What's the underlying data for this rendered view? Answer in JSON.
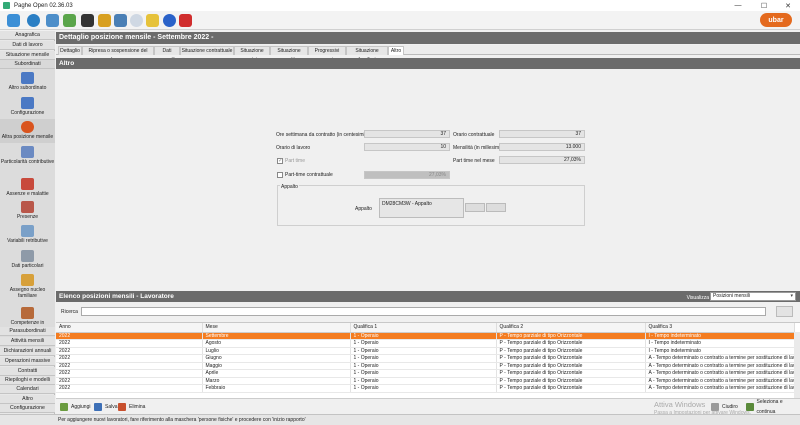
{
  "window": {
    "title": "Paghe Open 02.36.03",
    "brand": "ubar"
  },
  "toolbar_icons": [
    "home-icon",
    "globe-icon",
    "refresh-icon",
    "edit-icon",
    "bug-icon",
    "people-icon",
    "network-icon",
    "cloud-icon",
    "folder-icon",
    "info-icon",
    "close-icon"
  ],
  "sidebar": {
    "headers": [
      "Anagrafica",
      "Dati di lavoro",
      "Situazione mensile",
      "Subordinati"
    ],
    "items": [
      "Altro subordinato",
      "Configurazione",
      "Altra posizione mensile",
      "Particolarità contributive",
      "Assenze e malattie",
      "Presenze",
      "Variabili retributive",
      "Dati particolari",
      "Assegno nucleo familiare",
      "Competenze in"
    ],
    "footer": [
      "Parasubordinati",
      "Attività mensili",
      "Dichiarazioni annuali",
      "Operazioni massive",
      "Contratti",
      "Riepiloghi e modelli",
      "Calendari",
      "Altro",
      "Configurazione"
    ]
  },
  "detail": {
    "title": "Dettaglio posizione mensile - Settembre 2022 -",
    "tabs": [
      "Dettaglio",
      "Ripresa o sospensione del lavoro",
      "Dati mensili",
      "Situazione contrattuale",
      "Situazione ratei",
      "Situazione scatti",
      "Progressivi annui",
      "Situazione familiari",
      "Altro"
    ],
    "section": "Altro",
    "fields": {
      "ore_sett_label": "Ore settimana da contratto (in centesimi)",
      "ore_sett": "37",
      "orario_contr_label": "Orario contrattuale",
      "orario_contr": "37",
      "orario_lavoro_label": "Orario di lavoro",
      "orario_lavoro": "10",
      "mensilita_label": "Mensilità (in millesimi)",
      "mensilita": "13.000",
      "part_time_label": "Part time",
      "pt_mese_label": "Part time nel mese",
      "pt_mese": "27,03%",
      "pt_contr_label": "Part-time contrattuale",
      "pt_contr": "27,03%",
      "appalto_group": "Appalto",
      "appalto_label": "Appalto",
      "appalto_value": "DM28CM3W - Appalto"
    }
  },
  "list": {
    "title": "Elenco posizioni mensili - Lavoratore",
    "visualizza_label": "Visualizza",
    "visualizza_value": "Posizioni mensili",
    "search_label": "Ricerca",
    "columns": [
      "Anno",
      "Mese",
      "Qualifica 1",
      "Qualifica 2",
      "Qualifica 3"
    ],
    "rows": [
      [
        "2022",
        "Settembre",
        "1 - Operaio",
        "P - Tempo parziale di tipo Orizzontale",
        "I - Tempo indeterminato"
      ],
      [
        "2022",
        "Agosto",
        "1 - Operaio",
        "P - Tempo parziale di tipo Orizzontale",
        "I - Tempo indeterminato"
      ],
      [
        "2022",
        "Luglio",
        "1 - Operaio",
        "P - Tempo parziale di tipo Orizzontale",
        "I - Tempo indeterminato"
      ],
      [
        "2022",
        "Giugno",
        "1 - Operaio",
        "P - Tempo parziale di tipo Orizzontale",
        "A - Tempo determinato o contratto a termine per sostituzione di lavo..."
      ],
      [
        "2022",
        "Maggio",
        "1 - Operaio",
        "P - Tempo parziale di tipo Orizzontale",
        "A - Tempo determinato o contratto a termine per sostituzione di lavo..."
      ],
      [
        "2022",
        "Aprile",
        "1 - Operaio",
        "P - Tempo parziale di tipo Orizzontale",
        "A - Tempo determinato o contratto a termine per sostituzione di lavo..."
      ],
      [
        "2022",
        "Marzo",
        "1 - Operaio",
        "P - Tempo parziale di tipo Orizzontale",
        "A - Tempo determinato o contratto a termine per sostituzione di lavo..."
      ],
      [
        "2022",
        "Febbraio",
        "1 - Operaio",
        "P - Tempo parziale di tipo Orizzontale",
        "A - Tempo determinato o contratto a termine per sostituzione di lavo..."
      ]
    ],
    "buttons": {
      "add": "Aggiungi",
      "save": "Salva",
      "delete": "Elimina",
      "close": "Ciudiro",
      "select": "Seleziona e continua"
    }
  },
  "status": "Per aggiungere nuovi lavoratori, fare riferimento alla maschera 'persone fisiche' e procedere con 'inizio rapporto'",
  "watermark": {
    "line1": "Attiva Windows",
    "line2": "Passa a Impostazioni per attivare Windows."
  },
  "colors": {
    "accent": "#f47c20",
    "header": "#6b6b6b"
  }
}
